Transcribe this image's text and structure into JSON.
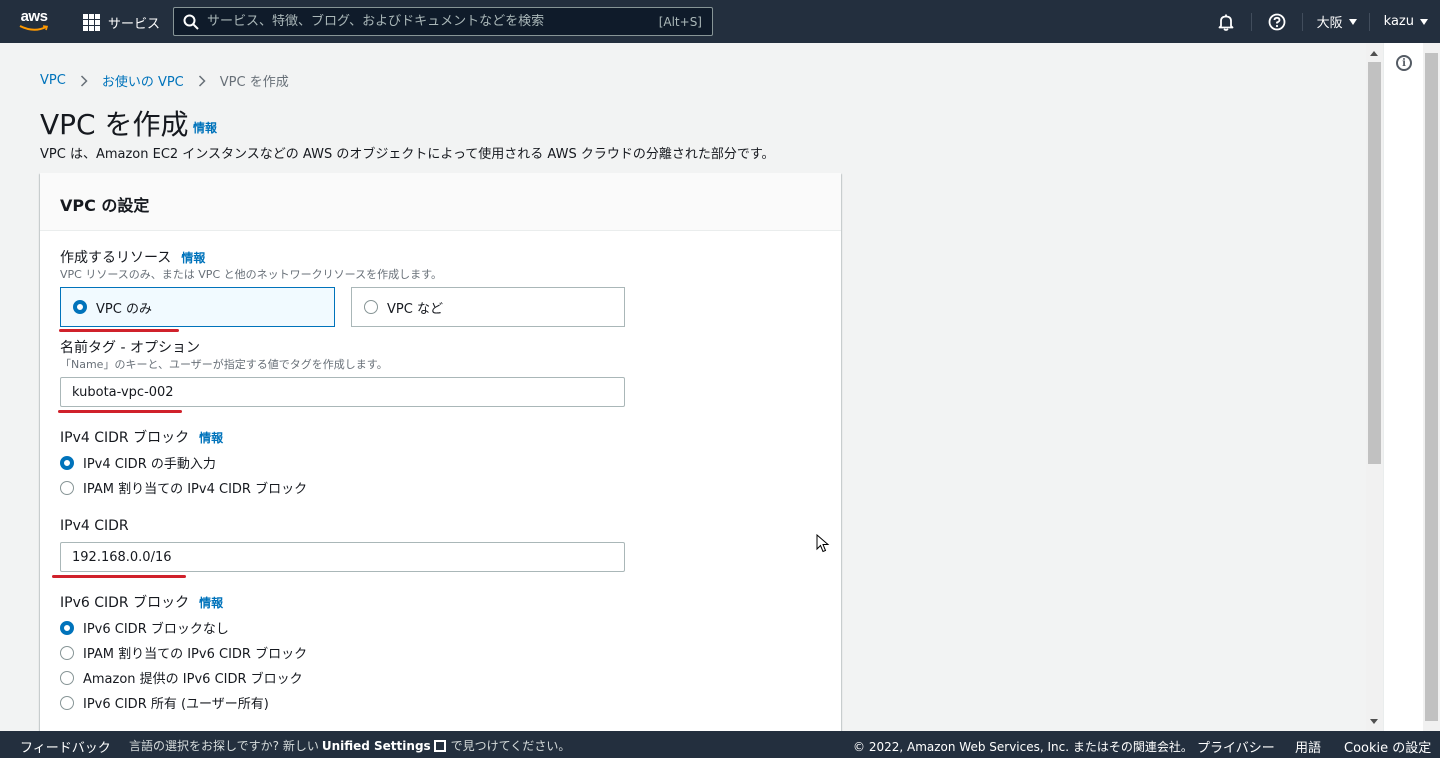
{
  "topnav": {
    "logo_text": "aws",
    "services_label": "サービス",
    "search_placeholder": "サービス、特徴、ブログ、およびドキュメントなどを検索",
    "search_shortcut": "[Alt+S]",
    "region": "大阪",
    "user": "kazu"
  },
  "breadcrumb": {
    "items": [
      "VPC",
      "お使いの VPC",
      "VPC を作成"
    ]
  },
  "header": {
    "title": "VPC を作成",
    "info": "情報",
    "description": "VPC は、Amazon EC2 インスタンスなどの AWS のオブジェクトによって使用される AWS クラウドの分離された部分です。"
  },
  "panel": {
    "title": "VPC の設定",
    "resources": {
      "label": "作成するリソース",
      "info": "情報",
      "description": "VPC リソースのみ、または VPC と他のネットワークリソースを作成します。",
      "options": [
        "VPC のみ",
        "VPC など"
      ],
      "selected": "VPC のみ"
    },
    "name_tag": {
      "label": "名前タグ - オプション",
      "description": "「Name」のキーと、ユーザーが指定する値でタグを作成します。",
      "value": "kubota-vpc-002"
    },
    "ipv4_block": {
      "label": "IPv4 CIDR ブロック",
      "info": "情報",
      "options": [
        "IPv4 CIDR の手動入力",
        "IPAM 割り当ての IPv4 CIDR ブロック"
      ],
      "selected": "IPv4 CIDR の手動入力"
    },
    "ipv4_cidr": {
      "label": "IPv4 CIDR",
      "value": "192.168.0.0/16"
    },
    "ipv6_block": {
      "label": "IPv6 CIDR ブロック",
      "info": "情報",
      "options": [
        "IPv6 CIDR ブロックなし",
        "IPAM 割り当ての IPv6 CIDR ブロック",
        "Amazon 提供の IPv6 CIDR ブロック",
        "IPv6 CIDR 所有 (ユーザー所有)"
      ],
      "selected": "IPv6 CIDR ブロックなし"
    }
  },
  "footer": {
    "feedback": "フィードバック",
    "lang_prefix": "言語の選択をお探しですか? 新しい",
    "lang_link": "Unified Settings",
    "lang_suffix": "で見つけてください。",
    "copyright": "© 2022, Amazon Web Services, Inc. またはその関連会社。",
    "privacy": "プライバシー",
    "terms": "用語",
    "cookie": "Cookie の設定"
  },
  "colors": {
    "nav_bg": "#232f3e",
    "link": "#0073bb",
    "annotation_red": "#d0212b"
  }
}
